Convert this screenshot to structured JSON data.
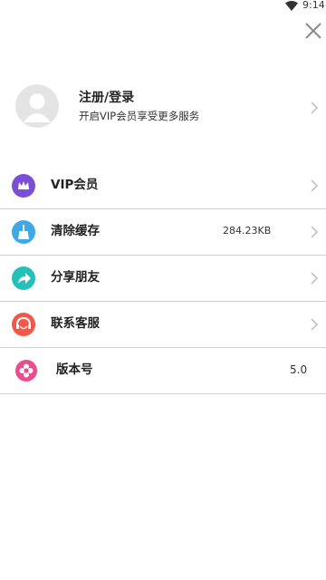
{
  "status_bar": {
    "time": "9:14",
    "icons": [
      "wifi-icon"
    ]
  },
  "header": {
    "close_icon": "close-icon"
  },
  "profile": {
    "title": "注册/登录",
    "subtitle": "开启VIP会员享受更多服务",
    "avatar_icon": "default-avatar-icon"
  },
  "menu": {
    "items": [
      {
        "label": "VIP会员",
        "value": "",
        "icon": "crown-icon",
        "icon_color": "#7a4fd6",
        "has_chevron": true
      },
      {
        "label": "清除缓存",
        "value": "284.23KB",
        "icon": "broom-icon",
        "icon_color": "#3fa9e8",
        "has_chevron": true
      },
      {
        "label": "分享朋友",
        "value": "",
        "icon": "share-icon",
        "icon_color": "#24c1b8",
        "has_chevron": true
      },
      {
        "label": "联系客服",
        "value": "",
        "icon": "customer-service-icon",
        "icon_color": "#f2584a",
        "has_chevron": true
      },
      {
        "label": "版本号",
        "value": "5.0",
        "icon": "flower-icon",
        "icon_color": "#e94d8e",
        "has_chevron": false
      }
    ]
  },
  "colors": {
    "background": "#ffffff",
    "divider": "#d2d2d2",
    "chevron": "#bbbbbb",
    "text_primary": "#222222"
  }
}
